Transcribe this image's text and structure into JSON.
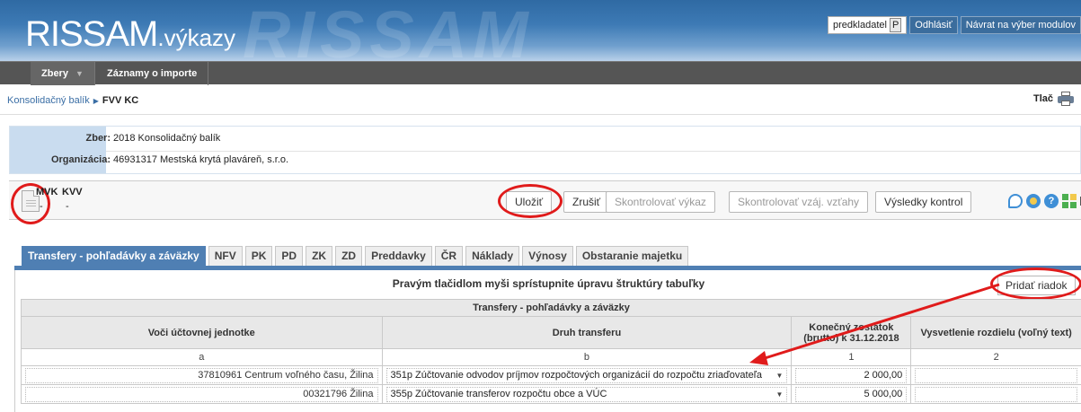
{
  "header": {
    "brand_main": "RISSAM",
    "brand_sub": ".výkazy",
    "watermark": "RISSAM",
    "user": "predkladatel",
    "user_icon_label": "P",
    "logout": "Odhlásiť",
    "back": "Návrat na výber modulov"
  },
  "nav": {
    "zbery": "Zbery",
    "zaznamy": "Záznamy o importe"
  },
  "breadcrumb": {
    "parent": "Konsolidačný balík",
    "current": "FVV KC",
    "print": "Tlač"
  },
  "info": {
    "zber_label": "Zber:",
    "zber_value": "2018 Konsolidačný balík",
    "org_label": "Organizácia:",
    "org_value": "46931317 Mestská krytá plaváreň, s.r.o."
  },
  "toolbar": {
    "mvk": "MVK",
    "kvv": "KVV",
    "mvk_value": "-",
    "kvv_value": "-",
    "save": "Uložiť",
    "cancel": "Zrušiť",
    "check_report": "Skontrolovať výkaz",
    "check_relations": "Skontrolovať vzáj. vzťahy",
    "results": "Výsledky kontrol"
  },
  "tabs": [
    {
      "label": "Transfery - pohľadávky a záväzky"
    },
    {
      "label": "NFV"
    },
    {
      "label": "PK"
    },
    {
      "label": "PD"
    },
    {
      "label": "ZK"
    },
    {
      "label": "ZD"
    },
    {
      "label": "Preddavky"
    },
    {
      "label": "ČR"
    },
    {
      "label": "Náklady"
    },
    {
      "label": "Výnosy"
    },
    {
      "label": "Obstaranie majetku"
    }
  ],
  "panel": {
    "hint": "Pravým tlačidlom myši sprístupnite úpravu štruktúry tabuľky",
    "add_row": "Pridať riadok"
  },
  "table": {
    "caption": "Transfery - pohľadávky a záväzky",
    "columns": [
      "Voči účtovnej jednotke",
      "Druh transferu",
      "Konečný zostatok (brutto) k 31.12.2018",
      "Vysvetlenie rozdielu (voľný text)"
    ],
    "letters": [
      "a",
      "b",
      "1",
      "2"
    ],
    "rows": [
      {
        "entity": "37810961 Centrum voľného času, Žilina",
        "transfer": "351p Zúčtovanie odvodov príjmov rozpočtových organizácií do rozpočtu zriaďovateľa",
        "balance": "2 000,00",
        "note": ""
      },
      {
        "entity": "00321796 Žilina",
        "transfer": "355p Zúčtovanie transferov rozpočtu obce a VÚC",
        "balance": "5 000,00",
        "note": ""
      }
    ]
  },
  "colors": {
    "header_blue": "#3d7ab5",
    "tab_active": "#4f7fb3",
    "annotation_red": "#e01b1b",
    "link": "#3a6ea5"
  }
}
